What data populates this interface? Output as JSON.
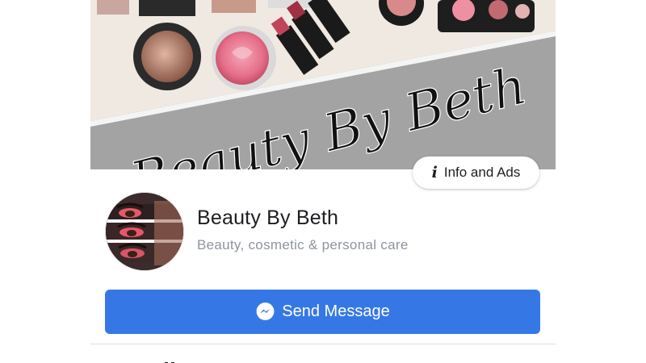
{
  "cover": {
    "banner_text": "Beauty By Beth"
  },
  "info_button": {
    "icon": "info-icon",
    "label": "Info and Ads"
  },
  "profile": {
    "name": "Beauty By Beth",
    "category": "Beauty, cosmetic & personal care"
  },
  "send_message": {
    "icon": "messenger-icon",
    "label": "Send Message"
  },
  "colors": {
    "accent": "#3578e5",
    "text_primary": "#1c1e21",
    "text_secondary": "#8d949e"
  }
}
